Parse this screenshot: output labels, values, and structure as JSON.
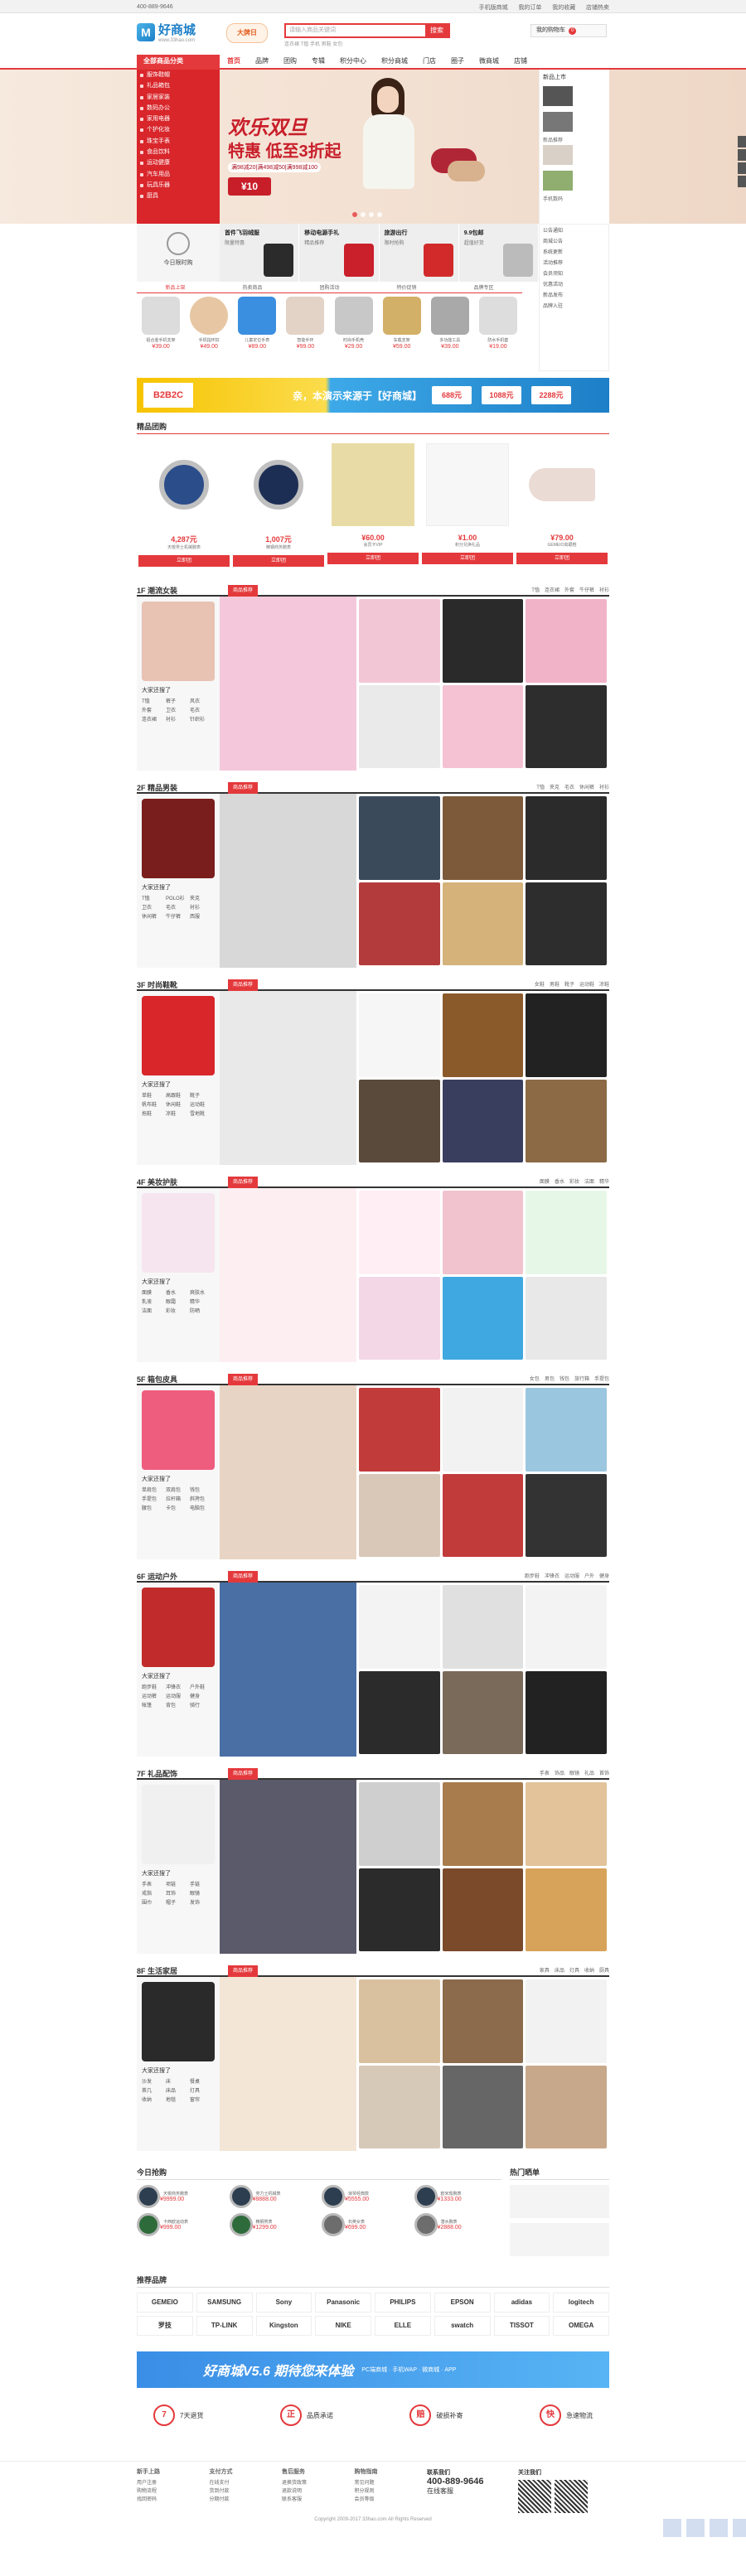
{
  "topbar": {
    "phone": "400-889-9646",
    "links": [
      "手机版商城",
      "我的订单",
      "我的收藏",
      "店铺热卖"
    ]
  },
  "header": {
    "logo_name": "好商城",
    "logo_url": "www.33hao.com",
    "logo_mark": "M",
    "promo_tag": "大牌日",
    "search_placeholder": "请输入商品关键词",
    "search_button": "搜索",
    "hot_words": "连衣裙  T恤  手机  男鞋  女包",
    "cart_label": "我的购物车",
    "cart_count": "0"
  },
  "nav": {
    "category": "全部商品分类",
    "items": [
      "首页",
      "品牌",
      "团购",
      "专辑",
      "积分中心",
      "积分商城",
      "门店",
      "圈子",
      "微商城",
      "店铺"
    ]
  },
  "side_categories": [
    "服饰鞋帽",
    "礼品箱包",
    "家居家装",
    "数码办公",
    "家用电器",
    "个护化妆",
    "珠宝手表",
    "食品饮料",
    "运动健康",
    "汽车用品",
    "玩具乐器",
    "厨具"
  ],
  "banner": {
    "title": "欢乐双旦",
    "subtitle": "特惠 低至3折起",
    "line": "满98减20|满498减50|满998减100",
    "coupon": "¥10"
  },
  "right_panel": {
    "title": "新品上市",
    "items": [
      "新品推荐",
      "手机数码"
    ]
  },
  "today": {
    "label": "今日限时购"
  },
  "promo_cells": [
    {
      "title": "首件飞羽绒服",
      "sub": "限量特惠"
    },
    {
      "title": "移动电源手礼",
      "sub": "精品推荐"
    },
    {
      "title": "旅游出行",
      "sub": "限时抢购"
    },
    {
      "title": "9.9包邮",
      "sub": "超值好货"
    }
  ],
  "tabs": [
    "新品上架",
    "热卖商品",
    "团购活动",
    "特价促销",
    "品牌专区"
  ],
  "products": [
    {
      "name": "铝合金手机支架",
      "price": "¥39.00"
    },
    {
      "name": "手机指环扣",
      "price": "¥49.00"
    },
    {
      "name": "儿童定位手表",
      "price": "¥89.00"
    },
    {
      "name": "智能手环",
      "price": "¥99.00"
    },
    {
      "name": "时尚手机壳",
      "price": "¥29.00"
    },
    {
      "name": "车载支架",
      "price": "¥59.00"
    },
    {
      "name": "多功能工具",
      "price": "¥39.00"
    },
    {
      "name": "防水手机套",
      "price": "¥19.00"
    }
  ],
  "news": [
    "公告通知",
    "商城公告",
    "系统更新",
    "活动推荐",
    "会员须知",
    "优惠活动",
    "新品发布",
    "品牌入驻"
  ],
  "b2b": {
    "logo": "B2B2C",
    "text": "亲，本演示来源于【好商城】",
    "coupons": [
      "688元",
      "1088元",
      "2288元"
    ]
  },
  "group": {
    "title": "精品团购",
    "items": [
      {
        "price": "4,287元",
        "name": "天梭男士机械腕表"
      },
      {
        "price": "1,007元",
        "name": "精钢商务腕表"
      },
      {
        "price": "¥60.00",
        "name": "会员卡VIP"
      },
      {
        "price": "¥1.00",
        "name": "积分兑换礼品"
      },
      {
        "price": "¥79.00",
        "name": "GEMEIO高跟鞋"
      }
    ],
    "button": "立即团"
  },
  "floors": [
    {
      "name": "1F 潮流女装",
      "badge": "商品推荐",
      "tabs": [
        "T恤",
        "连衣裙",
        "外套",
        "牛仔裤",
        "衬衫"
      ],
      "left_title": "大家还搜了",
      "tags": [
        "T恤",
        "裤子",
        "风衣",
        "外套",
        "卫衣",
        "毛衣",
        "连衣裙",
        "衬衫",
        "针织衫"
      ]
    },
    {
      "name": "2F 精品男装",
      "badge": "商品推荐",
      "tabs": [
        "T恤",
        "夹克",
        "毛衣",
        "休闲裤",
        "衬衫"
      ],
      "left_title": "大家还搜了",
      "tags": [
        "T恤",
        "POLO衫",
        "夹克",
        "卫衣",
        "毛衣",
        "衬衫",
        "休闲裤",
        "牛仔裤",
        "西服"
      ]
    },
    {
      "name": "3F 时尚鞋靴",
      "badge": "商品推荐",
      "tabs": [
        "女鞋",
        "男鞋",
        "靴子",
        "运动鞋",
        "凉鞋"
      ],
      "left_title": "大家还搜了",
      "tags": [
        "单鞋",
        "高跟鞋",
        "靴子",
        "帆布鞋",
        "休闲鞋",
        "运动鞋",
        "拖鞋",
        "凉鞋",
        "雪地靴"
      ]
    },
    {
      "name": "4F 美妆护肤",
      "badge": "商品推荐",
      "tabs": [
        "面膜",
        "香水",
        "彩妆",
        "洁面",
        "精华"
      ],
      "left_title": "大家还搜了",
      "tags": [
        "面膜",
        "香水",
        "爽肤水",
        "乳液",
        "眼霜",
        "精华",
        "洁面",
        "彩妆",
        "防晒"
      ]
    },
    {
      "name": "5F 箱包皮具",
      "badge": "商品推荐",
      "tabs": [
        "女包",
        "男包",
        "钱包",
        "旅行箱",
        "手提包"
      ],
      "left_title": "大家还搜了",
      "tags": [
        "单肩包",
        "双肩包",
        "钱包",
        "手提包",
        "拉杆箱",
        "斜挎包",
        "腰包",
        "卡包",
        "电脑包"
      ]
    },
    {
      "name": "6F 运动户外",
      "badge": "商品推荐",
      "tabs": [
        "跑步鞋",
        "冲锋衣",
        "运动服",
        "户外",
        "健身"
      ],
      "left_title": "大家还搜了",
      "tags": [
        "跑步鞋",
        "冲锋衣",
        "户外鞋",
        "运动裤",
        "运动服",
        "健身",
        "帐篷",
        "背包",
        "骑行"
      ]
    },
    {
      "name": "7F 礼品配饰",
      "badge": "商品推荐",
      "tabs": [
        "手表",
        "饰品",
        "眼镜",
        "礼品",
        "首饰"
      ],
      "left_title": "大家还搜了",
      "tags": [
        "手表",
        "项链",
        "手链",
        "戒指",
        "耳饰",
        "眼镜",
        "围巾",
        "帽子",
        "发饰"
      ]
    },
    {
      "name": "8F 生活家居",
      "badge": "商品推荐",
      "tabs": [
        "家具",
        "床品",
        "灯具",
        "收纳",
        "厨具"
      ],
      "left_title": "大家还搜了",
      "tags": [
        "沙发",
        "床",
        "餐桌",
        "茶几",
        "床品",
        "灯具",
        "收纳",
        "地毯",
        "窗帘"
      ]
    }
  ],
  "day_hot": {
    "title": "今日抢购",
    "items": [
      {
        "name": "天梭商务腕表",
        "price": "¥9999.00"
      },
      {
        "name": "劳力士机械表",
        "price": "¥8888.00"
      },
      {
        "name": "浪琴经典款",
        "price": "¥5555.00"
      },
      {
        "name": "欧米茄腕表",
        "price": "¥1333.00"
      },
      {
        "name": "卡西欧运动表",
        "price": "¥999.00"
      },
      {
        "name": "精钢男表",
        "price": "¥1299.00"
      },
      {
        "name": "石英女表",
        "price": "¥699.00"
      },
      {
        "name": "潜水腕表",
        "price": "¥2888.00"
      }
    ],
    "right_title": "热门晒单"
  },
  "brands": {
    "title": "推荐品牌",
    "items": [
      "GEMEIO",
      "SAMSUNG",
      "Sony",
      "Panasonic",
      "PHILIPS",
      "EPSON",
      "adidas",
      "logitech",
      "罗技",
      "TP-LINK",
      "Kingston",
      "NIKE",
      "ELLE",
      "swatch",
      "TISSOT",
      "OMEGA"
    ]
  },
  "version": {
    "title": "好商城V5.6 期待您来体验",
    "sub": "PC端商城 · 手机WAP · 微商城 · APP"
  },
  "services": [
    {
      "icon": "7",
      "text": "7天退货"
    },
    {
      "icon": "正",
      "text": "品质承诺"
    },
    {
      "icon": "赔",
      "text": "破损补寄"
    },
    {
      "icon": "快",
      "text": "急速物流"
    }
  ],
  "footer": {
    "cols": [
      {
        "head": "新手上路",
        "items": [
          "用户注册",
          "购物流程",
          "找回密码"
        ]
      },
      {
        "head": "支付方式",
        "items": [
          "在线支付",
          "货到付款",
          "分期付款"
        ]
      },
      {
        "head": "售后服务",
        "items": [
          "退换货政策",
          "退款说明",
          "联系客服"
        ]
      },
      {
        "head": "购物指南",
        "items": [
          "常见问题",
          "积分规则",
          "会员等级"
        ]
      }
    ],
    "contact_head": "联系我们",
    "phone": "400-889-9646",
    "online": "在线客服",
    "qr_label": "关注我们",
    "copyright": "Copyright 2009-2017 33hao.com All Rights Reserved"
  }
}
